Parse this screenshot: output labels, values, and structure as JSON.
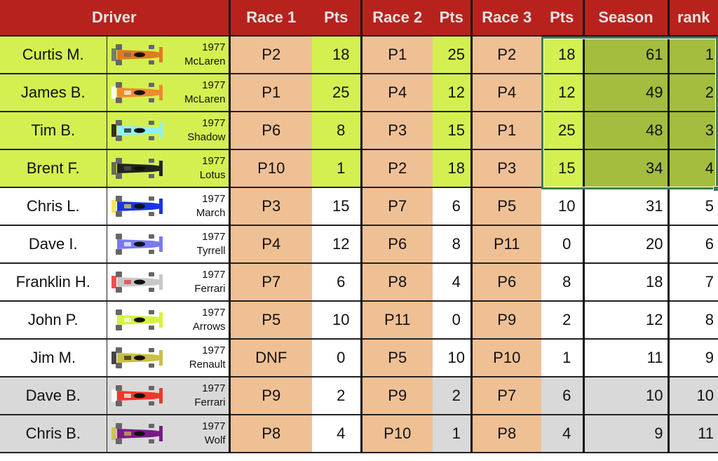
{
  "colors": {
    "header_bg": "#b8221c",
    "header_text": "#e4e4e4",
    "top4_bg": "#d4f050",
    "top4_selected_bg": "#a4bd3e",
    "position_bg": "#f0c095",
    "mid_bg": "#ffffff",
    "bottom_bg": "#d9d9d9",
    "selection_border": "#3f7b52"
  },
  "header": {
    "driver": "Driver",
    "race1": "Race 1",
    "pts1": "Pts",
    "race2": "Race 2",
    "pts2": "Pts",
    "race3": "Race 3",
    "pts3": "Pts",
    "season": "Season",
    "rank": "rank"
  },
  "rows": [
    {
      "driver": "Curtis M.",
      "year": "1977",
      "team": "McLaren",
      "car_icon": "mclaren-car-icon",
      "car_colors": [
        "#e07a20",
        "#6a6a6a"
      ],
      "tier": "top",
      "r1": "P2",
      "p1": "18",
      "p1_tier": "top",
      "r2": "P1",
      "p2": "25",
      "p2_tier": "top",
      "r3": "P2",
      "p3": "18",
      "season": "61",
      "rank": "1"
    },
    {
      "driver": "James B.",
      "year": "1977",
      "team": "McLaren",
      "car_icon": "mclaren-car-icon",
      "car_colors": [
        "#f08a30",
        "#ffffff"
      ],
      "tier": "top",
      "r1": "P1",
      "p1": "25",
      "p1_tier": "top",
      "r2": "P4",
      "p2": "12",
      "p2_tier": "top",
      "r3": "P4",
      "p3": "12",
      "season": "49",
      "rank": "2"
    },
    {
      "driver": "Tim B.",
      "year": "1977",
      "team": "Shadow",
      "car_icon": "shadow-car-icon",
      "car_colors": [
        "#8ff0f8",
        "#111111"
      ],
      "tier": "top",
      "r1": "P6",
      "p1": "8",
      "p1_tier": "top",
      "r2": "P3",
      "p2": "15",
      "p2_tier": "top",
      "r3": "P1",
      "p3": "25",
      "season": "48",
      "rank": "3"
    },
    {
      "driver": "Brent F.",
      "year": "1977",
      "team": "Lotus",
      "car_icon": "lotus-car-icon",
      "car_colors": [
        "#222222",
        "#555555"
      ],
      "tier": "top",
      "r1": "P10",
      "p1": "1",
      "p1_tier": "top",
      "r2": "P2",
      "p2": "18",
      "p2_tier": "top",
      "r3": "P3",
      "p3": "15",
      "season": "34",
      "rank": "4"
    },
    {
      "driver": "Chris L.",
      "year": "1977",
      "team": "March",
      "car_icon": "march-car-icon",
      "car_colors": [
        "#1a35e0",
        "#f0e040"
      ],
      "tier": "mid",
      "r1": "P3",
      "p1": "15",
      "p1_tier": "mid",
      "r2": "P7",
      "p2": "6",
      "p2_tier": "mid",
      "r3": "P5",
      "p3": "10",
      "season": "31",
      "rank": "5"
    },
    {
      "driver": "Dave I.",
      "year": "1977",
      "team": "Tyrrell",
      "car_icon": "tyrrell-car-icon",
      "car_colors": [
        "#7a7af0",
        "#ffffff"
      ],
      "tier": "mid",
      "r1": "P4",
      "p1": "12",
      "p1_tier": "mid",
      "r2": "P6",
      "p2": "8",
      "p2_tier": "mid",
      "r3": "P11",
      "p3": "0",
      "season": "20",
      "rank": "6"
    },
    {
      "driver": "Franklin H.",
      "year": "1977",
      "team": "Ferrari",
      "car_icon": "ferrari-car-icon",
      "car_colors": [
        "#c8c8c8",
        "#f03030"
      ],
      "tier": "mid",
      "r1": "P7",
      "p1": "6",
      "p1_tier": "mid",
      "r2": "P8",
      "p2": "4",
      "p2_tier": "mid",
      "r3": "P6",
      "p3": "8",
      "season": "18",
      "rank": "7"
    },
    {
      "driver": "John P.",
      "year": "1977",
      "team": "Arrows",
      "car_icon": "arrows-car-icon",
      "car_colors": [
        "#d8f040",
        "#ffffff"
      ],
      "tier": "mid",
      "r1": "P5",
      "p1": "10",
      "p1_tier": "mid",
      "r2": "P11",
      "p2": "0",
      "p2_tier": "mid",
      "r3": "P9",
      "p3": "2",
      "season": "12",
      "rank": "8"
    },
    {
      "driver": "Jim M.",
      "year": "1977",
      "team": "Renault",
      "car_icon": "renault-car-icon",
      "car_colors": [
        "#c8c040",
        "#222222"
      ],
      "tier": "mid",
      "r1": "DNF",
      "p1": "0",
      "p1_tier": "mid",
      "r2": "P5",
      "p2": "10",
      "p2_tier": "mid",
      "r3": "P10",
      "p3": "1",
      "season": "11",
      "rank": "9"
    },
    {
      "driver": "Dave B.",
      "year": "1977",
      "team": "Ferrari",
      "car_icon": "ferrari-car-icon",
      "car_colors": [
        "#f03828",
        "#ffffff"
      ],
      "tier": "bottom",
      "r1": "P9",
      "p1": "2",
      "p1_tier": "mid",
      "r2": "P9",
      "p2": "2",
      "p2_tier": "bottom",
      "r3": "P7",
      "p3": "6",
      "season": "10",
      "rank": "10"
    },
    {
      "driver": "Chris B.",
      "year": "1977",
      "team": "Wolf",
      "car_icon": "wolf-car-icon",
      "car_colors": [
        "#7a1a8a",
        "#c8c040"
      ],
      "tier": "bottom",
      "r1": "P8",
      "p1": "4",
      "p1_tier": "mid",
      "r2": "P10",
      "p2": "1",
      "p2_tier": "bottom",
      "r3": "P8",
      "p3": "4",
      "season": "9",
      "rank": "11"
    }
  ]
}
